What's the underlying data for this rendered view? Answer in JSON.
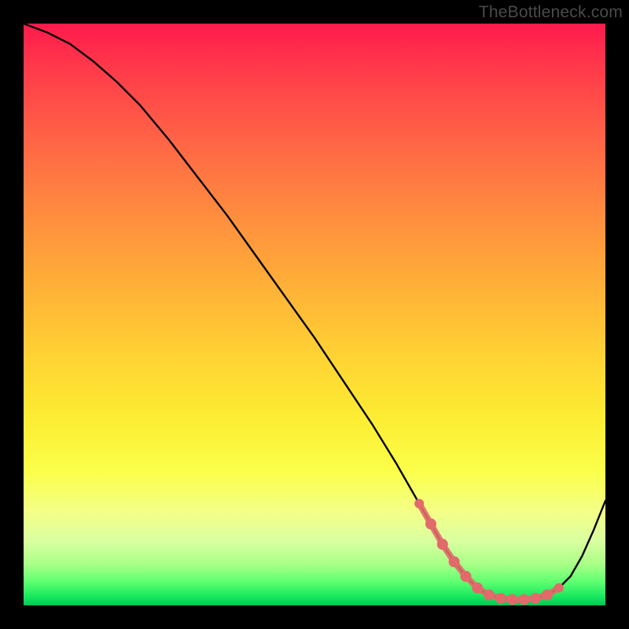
{
  "watermark": "TheBottleneck.com",
  "chart_data": {
    "type": "line",
    "title": "",
    "xlabel": "",
    "ylabel": "",
    "xlim": [
      0,
      100
    ],
    "ylim": [
      0,
      100
    ],
    "grid": false,
    "legend": false,
    "series": [
      {
        "name": "bottleneck-curve",
        "color": "#000000",
        "x": [
          0,
          4,
          8,
          12,
          16,
          20,
          25,
          30,
          35,
          40,
          45,
          50,
          55,
          60,
          64,
          68,
          70,
          72,
          74,
          76,
          78,
          80,
          82,
          84,
          86,
          88,
          90,
          92,
          94,
          96,
          98,
          100
        ],
        "y": [
          100,
          98.5,
          96.5,
          93.5,
          90,
          86,
          80,
          73.5,
          67,
          60,
          53,
          46,
          38.5,
          31,
          24.5,
          17.5,
          14,
          10.5,
          7.5,
          5,
          3,
          1.8,
          1.2,
          1,
          1,
          1.2,
          1.8,
          3,
          5,
          8.5,
          13,
          18
        ]
      },
      {
        "name": "optimal-band-markers",
        "color": "#e26a6a",
        "type": "scatter",
        "x": [
          68,
          70,
          72,
          74,
          76,
          78,
          80,
          82,
          84,
          86,
          88,
          90,
          92
        ],
        "y": [
          17.5,
          14,
          10.5,
          7.5,
          5,
          3,
          1.8,
          1.2,
          1,
          1,
          1.2,
          1.8,
          3
        ]
      }
    ],
    "background_gradient": {
      "top": "#ff1a4d",
      "mid1": "#ff8a3f",
      "mid2": "#ffe040",
      "bottom": "#00c853"
    }
  }
}
